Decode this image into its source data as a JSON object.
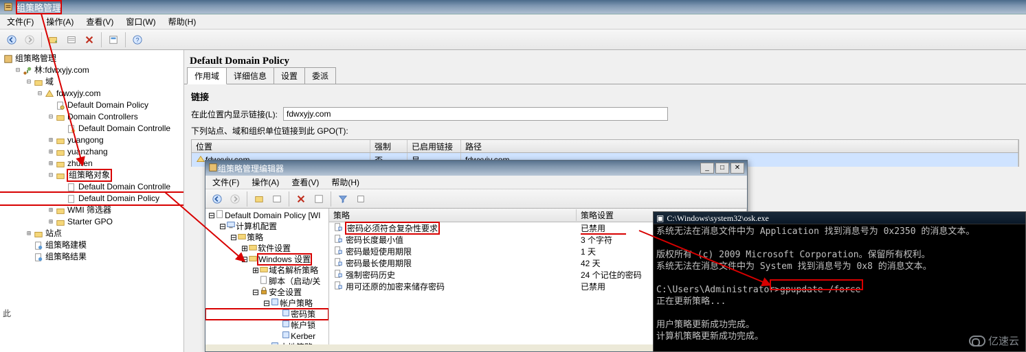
{
  "titlebar": {
    "title": "组策略管理"
  },
  "menus": {
    "file": "文件(F)",
    "action": "操作(A)",
    "view": "查看(V)",
    "window": "窗口(W)",
    "help": "帮助(H)"
  },
  "toolbar_icons": [
    "back",
    "forward",
    "up",
    "list",
    "refresh",
    "delete",
    "props",
    "help"
  ],
  "tree": {
    "root": "组策略管理",
    "forest_prefix": "林: ",
    "forest": "fdwxyjy.com",
    "domains": "域",
    "domain": "fdwxyjy.com",
    "ddp": "Default Domain Policy",
    "dc": "Domain Controllers",
    "ddcp": "Default Domain Controlle",
    "ou1": "yuangong",
    "ou2": "yuanzhang",
    "ou3": "zhuren",
    "gpo_obj": "组策略对象",
    "gpo1": "Default Domain Controlle",
    "gpo2": "Default Domain Policy",
    "wmi": "WMI 筛选器",
    "starter": "Starter GPO",
    "sites": "站点",
    "modeling": "组策略建模",
    "results": "组策略结果"
  },
  "right": {
    "title": "Default Domain Policy",
    "tabs": {
      "scope": "作用域",
      "details": "详细信息",
      "settings": "设置",
      "delegation": "委派"
    },
    "links_heading": "链接",
    "show_links_label": "在此位置内显示链接(L):",
    "show_links_value": "fdwxyjy.com",
    "gpo_links_label": "下列站点、域和组织单位链接到此 GPO(T):",
    "cols": {
      "loc": "位置",
      "force": "强制",
      "link": "已启用链接",
      "path": "路径"
    },
    "row": {
      "loc": "fdwxyjy.com",
      "force": "否",
      "link": "是",
      "path": "fdwxyjy.com"
    }
  },
  "editor": {
    "title": "组策略管理编辑器",
    "menus": {
      "file": "文件(F)",
      "action": "操作(A)",
      "view": "查看(V)",
      "help": "帮助(H)"
    },
    "tree": {
      "root": "Default Domain Policy [WI",
      "comp": "计算机配置",
      "pol": "策略",
      "sw": "软件设置",
      "win": "Windows 设置",
      "dns": "域名解析策略",
      "script": "脚本（启动/关",
      "sec": "安全设置",
      "acct": "帐户策略",
      "pwd": "密码策",
      "lock": "帐户锁",
      "kerb": "Kerber",
      "local": "本地策略"
    },
    "cols": {
      "policy": "策略",
      "setting": "策略设置"
    },
    "rows": [
      {
        "p": "密码必须符合复杂性要求",
        "s": "已禁用"
      },
      {
        "p": "密码长度最小值",
        "s": "3 个字符"
      },
      {
        "p": "密码最短使用期限",
        "s": "1 天"
      },
      {
        "p": "密码最长使用期限",
        "s": "42 天"
      },
      {
        "p": "强制密码历史",
        "s": "24 个记住的密码"
      },
      {
        "p": "用可还原的加密来储存密码",
        "s": "已禁用"
      }
    ],
    "status_label": "此"
  },
  "cmd": {
    "title": "C:\\Windows\\system32\\osk.exe",
    "lines": [
      "系统无法在消息文件中为 Application 找到消息号为 0x2350 的消息文本。",
      "",
      "版权所有 (c) 2009 Microsoft Corporation。保留所有权利。",
      "系统无法在消息文件中为 System 找到消息号为 0x8 的消息文本。",
      "",
      "C:\\Users\\Administrator>gpupdate /force",
      "正在更新策略...",
      "",
      "用户策略更新成功完成。",
      "计算机策略更新成功完成。"
    ],
    "highlight": "gpupdate /force"
  },
  "watermark": "亿速云"
}
